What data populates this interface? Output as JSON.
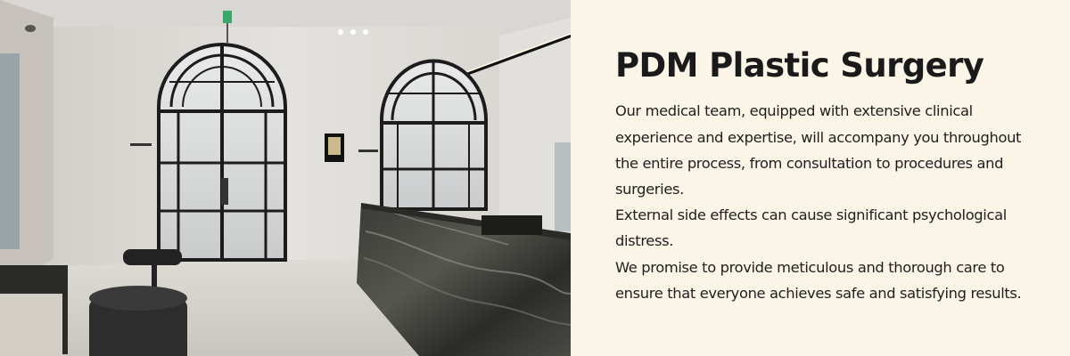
{
  "heading": "PDM Plastic Surgery",
  "paragraphs": [
    "Our medical team, equipped with extensive clinical experience and expertise, will accompany you throughout the entire process, from consultation to procedures and surgeries.",
    "External side effects can cause significant psychological distress.",
    "We promise to provide meticulous and thorough care to ensure that everyone achieves safe and satisfying results."
  ],
  "colors": {
    "background": "#fbf5e8",
    "text": "#1a1a1a"
  }
}
